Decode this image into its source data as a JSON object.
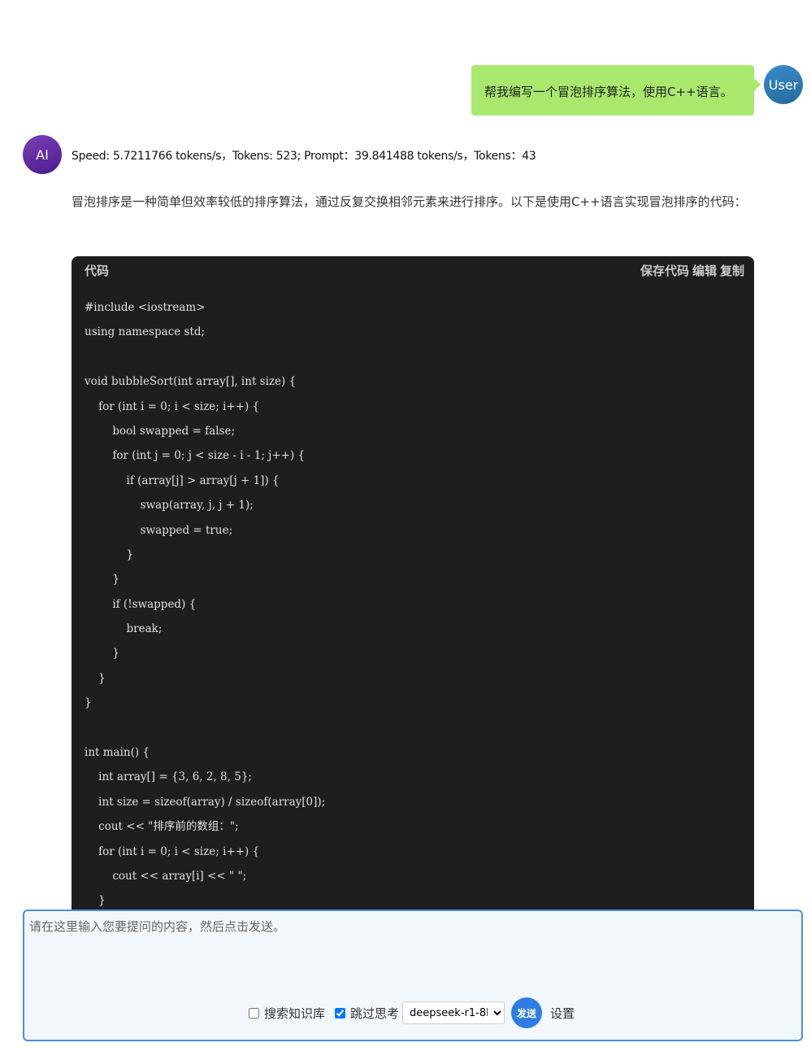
{
  "user_message": {
    "text": "帮我编写一个冒泡排序算法，使用C++语言。",
    "avatar_label": "User"
  },
  "ai_message": {
    "avatar_label": "AI",
    "stats": "Speed: 5.7211766 tokens/s，Tokens: 523; Prompt：39.841488 tokens/s，Tokens：43",
    "intro": "冒泡排序是一种简单但效率较低的排序算法，通过反复交换相邻元素来进行排序。以下是使用C++语言实现冒泡排序的代码：",
    "code": {
      "title": "代码",
      "actions": [
        "保存代码",
        "编辑",
        "复制"
      ],
      "lines": [
        "#include <iostream>",
        "using namespace std;",
        "",
        "void bubbleSort(int array[], int size) {",
        "    for (int i = 0; i < size; i++) {",
        "        bool swapped = false;",
        "        for (int j = 0; j < size - i - 1; j++) {",
        "            if (array[j] > array[j + 1]) {",
        "                swap(array, j, j + 1);",
        "                swapped = true;",
        "            }",
        "        }",
        "        if (!swapped) {",
        "            break;",
        "        }",
        "    }",
        "}",
        "",
        "int main() {",
        "    int array[] = {3, 6, 2, 8, 5};",
        "    int size = sizeof(array) / sizeof(array[0]);",
        "    cout << \"排序前的数组：\";",
        "    for (int i = 0; i < size; i++) {",
        "        cout << array[i] << \" \";",
        "    }"
      ]
    }
  },
  "input": {
    "placeholder": "请在这里输入您要提问的内容，然后点击发送。",
    "value": "",
    "search_kb_label": "搜索知识库",
    "search_kb_checked": false,
    "skip_think_label": "跳过思考",
    "skip_think_checked": true,
    "model_selected": "deepseek-r1-8b",
    "send_label": "发送",
    "settings_label": "设置"
  },
  "colors": {
    "user_bubble": "#a8e86d",
    "code_bg": "#1e1e1e",
    "send_button": "#2e7de3",
    "input_border": "#4a90e2"
  }
}
